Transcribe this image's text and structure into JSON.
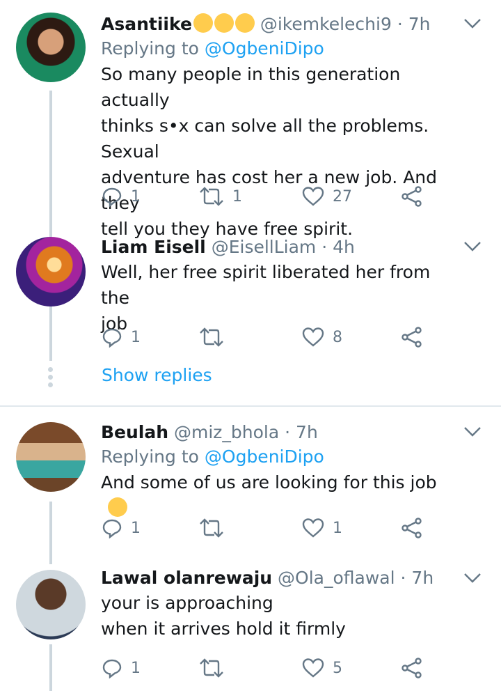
{
  "tweets": [
    {
      "name": "Asantiike",
      "handle": "@ikemkelechi9",
      "time": "· 7h",
      "replying_label": "Replying to ",
      "replying_to": "@OgbeniDipo",
      "lines": [
        "So many people in this generation actually",
        "thinks s•x can solve all the problems. Sexual",
        "adventure has cost her a new job. And they",
        "tell you they have free spirit."
      ],
      "reply_count": "1",
      "retweet_count": "1",
      "like_count": "27"
    },
    {
      "name": "Liam Eisell",
      "handle": "@EisellLiam",
      "time": "· 4h",
      "lines": [
        "Well, her free spirit liberated her from the",
        "job"
      ],
      "reply_count": "1",
      "retweet_count": "",
      "like_count": "8"
    },
    {
      "name": "Beulah",
      "handle": "@miz_bhola",
      "time": "· 7h",
      "replying_label": "Replying to ",
      "replying_to": "@OgbeniDipo",
      "lines": [
        "And some of us are looking for this job"
      ],
      "reply_count": "1",
      "retweet_count": "",
      "like_count": "1"
    },
    {
      "name": "Lawal olanrewaju",
      "handle": "@Ola_oflawal",
      "time": "· 7h",
      "lines": [
        "your is approaching",
        "when it arrives hold it firmly"
      ],
      "reply_count": "1",
      "retweet_count": "",
      "like_count": "5"
    }
  ],
  "show_replies": "Show replies",
  "colors": {
    "accent": "#1da1f2",
    "secondary": "#657786",
    "line": "#ccd6dd"
  },
  "icons": [
    "reply-icon",
    "retweet-icon",
    "like-icon",
    "share-icon",
    "chevron-down-icon"
  ]
}
